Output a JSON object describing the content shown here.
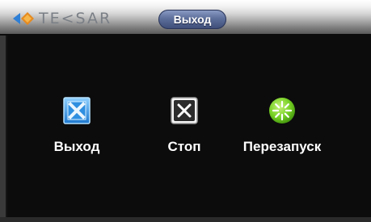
{
  "window": {
    "brand": "TE<SAR",
    "title": "Выход"
  },
  "actions": [
    {
      "label": "Выход",
      "icon": "exit-icon",
      "color": "#3fa0e6"
    },
    {
      "label": "Стоп",
      "icon": "stop-icon",
      "color": "#f0f0f0"
    },
    {
      "label": "Перезапуск",
      "icon": "restart-icon",
      "color": "#7fd52a"
    }
  ]
}
